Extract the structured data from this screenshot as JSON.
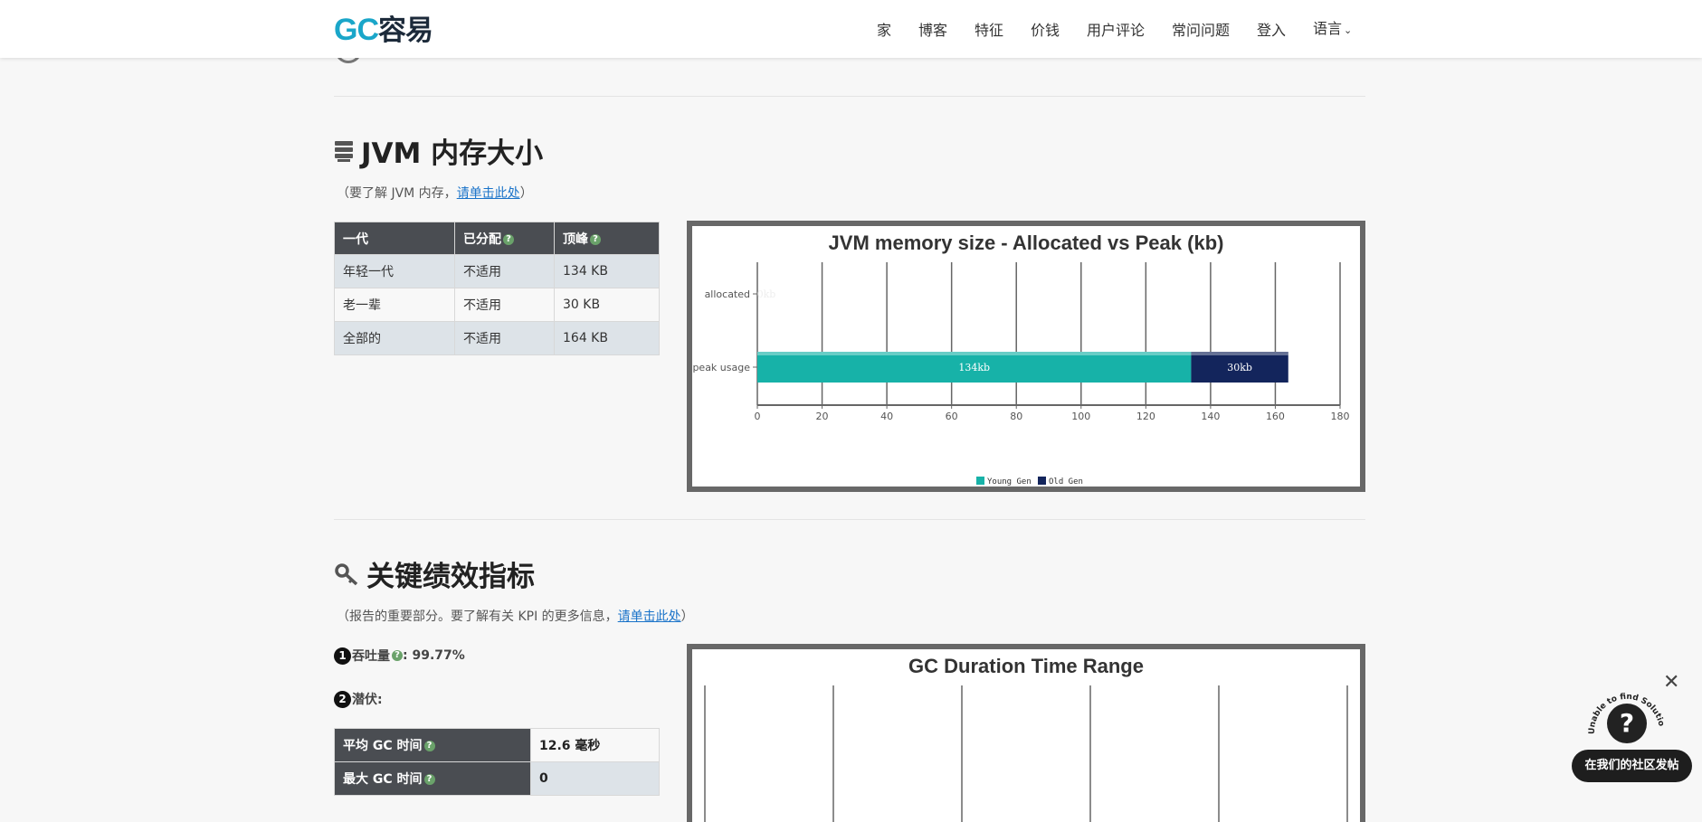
{
  "header": {
    "logo_gc": "GC",
    "logo_rest": "容易",
    "nav": [
      "家",
      "博客",
      "特征",
      "价钱",
      "用户评论",
      "常问问题",
      "登入",
      "语言"
    ]
  },
  "jvm_section": {
    "title": "JVM 内存大小",
    "subtitle_pre": "（要了解 JVM 内存，",
    "subtitle_link": "请单击此处",
    "subtitle_post": "）",
    "table": {
      "headers": [
        "一代",
        "已分配",
        "顶峰"
      ],
      "rows": [
        [
          "年轻一代",
          "不适用",
          "134 KB"
        ],
        [
          "老一辈",
          "不适用",
          "30 KB"
        ],
        [
          "全部的",
          "不适用",
          "164 KB"
        ]
      ]
    }
  },
  "kpi_section": {
    "title": "关键绩效指标",
    "subtitle_pre": "（报告的重要部分。要了解有关 KPI 的更多信息，",
    "subtitle_link": "请单击此处",
    "subtitle_post": "）",
    "throughput_num": "1",
    "throughput_label": "吞吐量",
    "throughput_value": ": 99.77%",
    "latency_num": "2",
    "latency_label": "潜伏:",
    "gc_table": [
      [
        "平均 GC 时间",
        "12.6 毫秒"
      ],
      [
        "最大 GC 时间",
        "0"
      ]
    ]
  },
  "widget": {
    "arc_text": "Unable to find Solution?",
    "q": "?",
    "button": "在我们的社区发帖",
    "close": "✕"
  },
  "chart_data": [
    {
      "type": "bar",
      "title": "JVM memory size - Allocated vs Peak (kb)",
      "categories": [
        "allocated",
        "peak usage"
      ],
      "series": [
        {
          "name": "Young Gen",
          "values": [
            0,
            134
          ],
          "labels": [
            "0kb",
            "134kb"
          ],
          "color": "#17b2a8"
        },
        {
          "name": "Old Gen",
          "values": [
            0,
            30
          ],
          "labels": [
            "",
            "30kb"
          ],
          "color": "#13255c"
        }
      ],
      "stacked": true,
      "orientation": "horizontal",
      "xlim": [
        0,
        180
      ],
      "xticks": [
        0,
        20,
        40,
        60,
        80,
        100,
        120,
        140,
        160,
        180
      ],
      "grid": true,
      "legend": "bottom"
    },
    {
      "type": "bar",
      "title": "GC Duration Time Range",
      "grid": true
    }
  ]
}
